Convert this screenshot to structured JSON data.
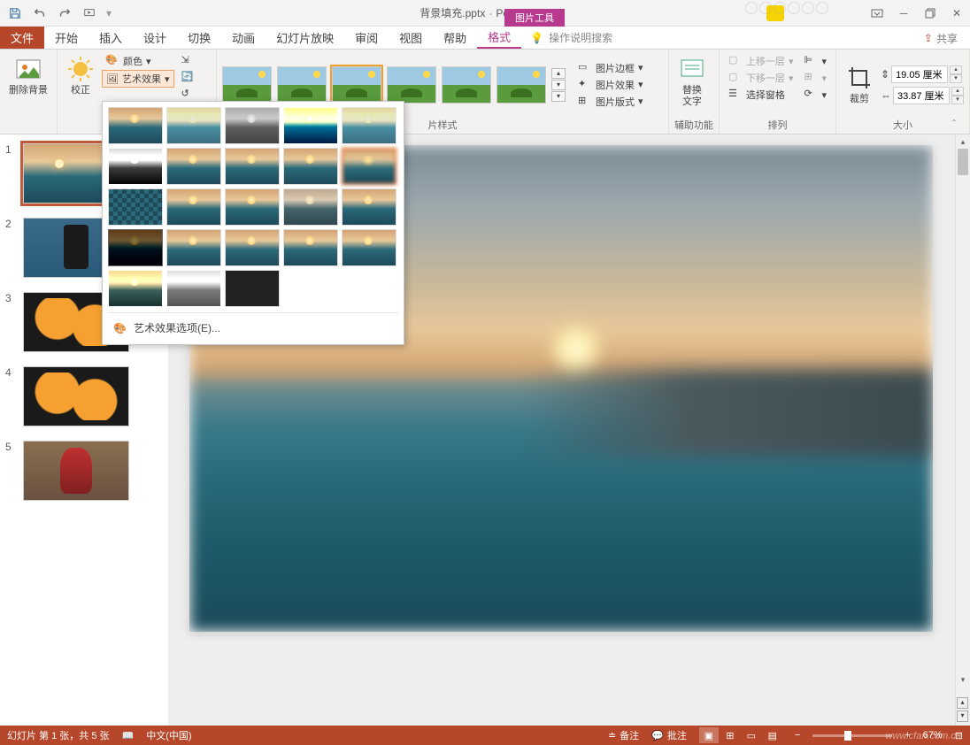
{
  "title": {
    "filename": "背景填充.pptx",
    "app": "PowerPoint",
    "context_tab": "图片工具"
  },
  "qat": {
    "save": "保存",
    "undo": "撤销",
    "redo": "重做",
    "start": "从头开始"
  },
  "share": "共享",
  "tabs": {
    "file": "文件",
    "home": "开始",
    "insert": "插入",
    "design": "设计",
    "transitions": "切换",
    "animations": "动画",
    "slideshow": "幻灯片放映",
    "review": "审阅",
    "view": "视图",
    "help": "帮助",
    "format": "格式"
  },
  "tellme": {
    "placeholder": "操作说明搜索"
  },
  "ribbon": {
    "remove_bg": "删除背景",
    "corrections": "校正",
    "color": "颜色",
    "artistic": "艺术效果",
    "adjust_reset": "重设",
    "adjust_compress": "压缩",
    "styles_label": "片样式",
    "border": "图片边框",
    "effects": "图片效果",
    "layout": "图片版式",
    "alt_text": "替换\n文字",
    "accessibility_label": "辅助功能",
    "bring_forward": "上移一层",
    "send_backward": "下移一层",
    "selection_pane": "选择窗格",
    "arrange_label": "排列",
    "crop": "裁剪",
    "height": "19.05 厘米",
    "width": "33.87 厘米",
    "size_label": "大小"
  },
  "artistic_options": "艺术效果选项(E)...",
  "thumbs": [
    {
      "n": "1",
      "cls": "sp-ocean",
      "active": true
    },
    {
      "n": "2",
      "cls": "sp-phone",
      "active": false
    },
    {
      "n": "3",
      "cls": "sp-orange",
      "active": false
    },
    {
      "n": "4",
      "cls": "sp-orange",
      "active": false
    },
    {
      "n": "5",
      "cls": "sp-spider",
      "active": false
    }
  ],
  "status": {
    "slide_info": "幻灯片 第 1 张，共 5 张",
    "lang": "中文(中国)",
    "notes": "备注",
    "comments": "批注",
    "zoom": "67%"
  },
  "watermark": "www.cfan.com.cn"
}
